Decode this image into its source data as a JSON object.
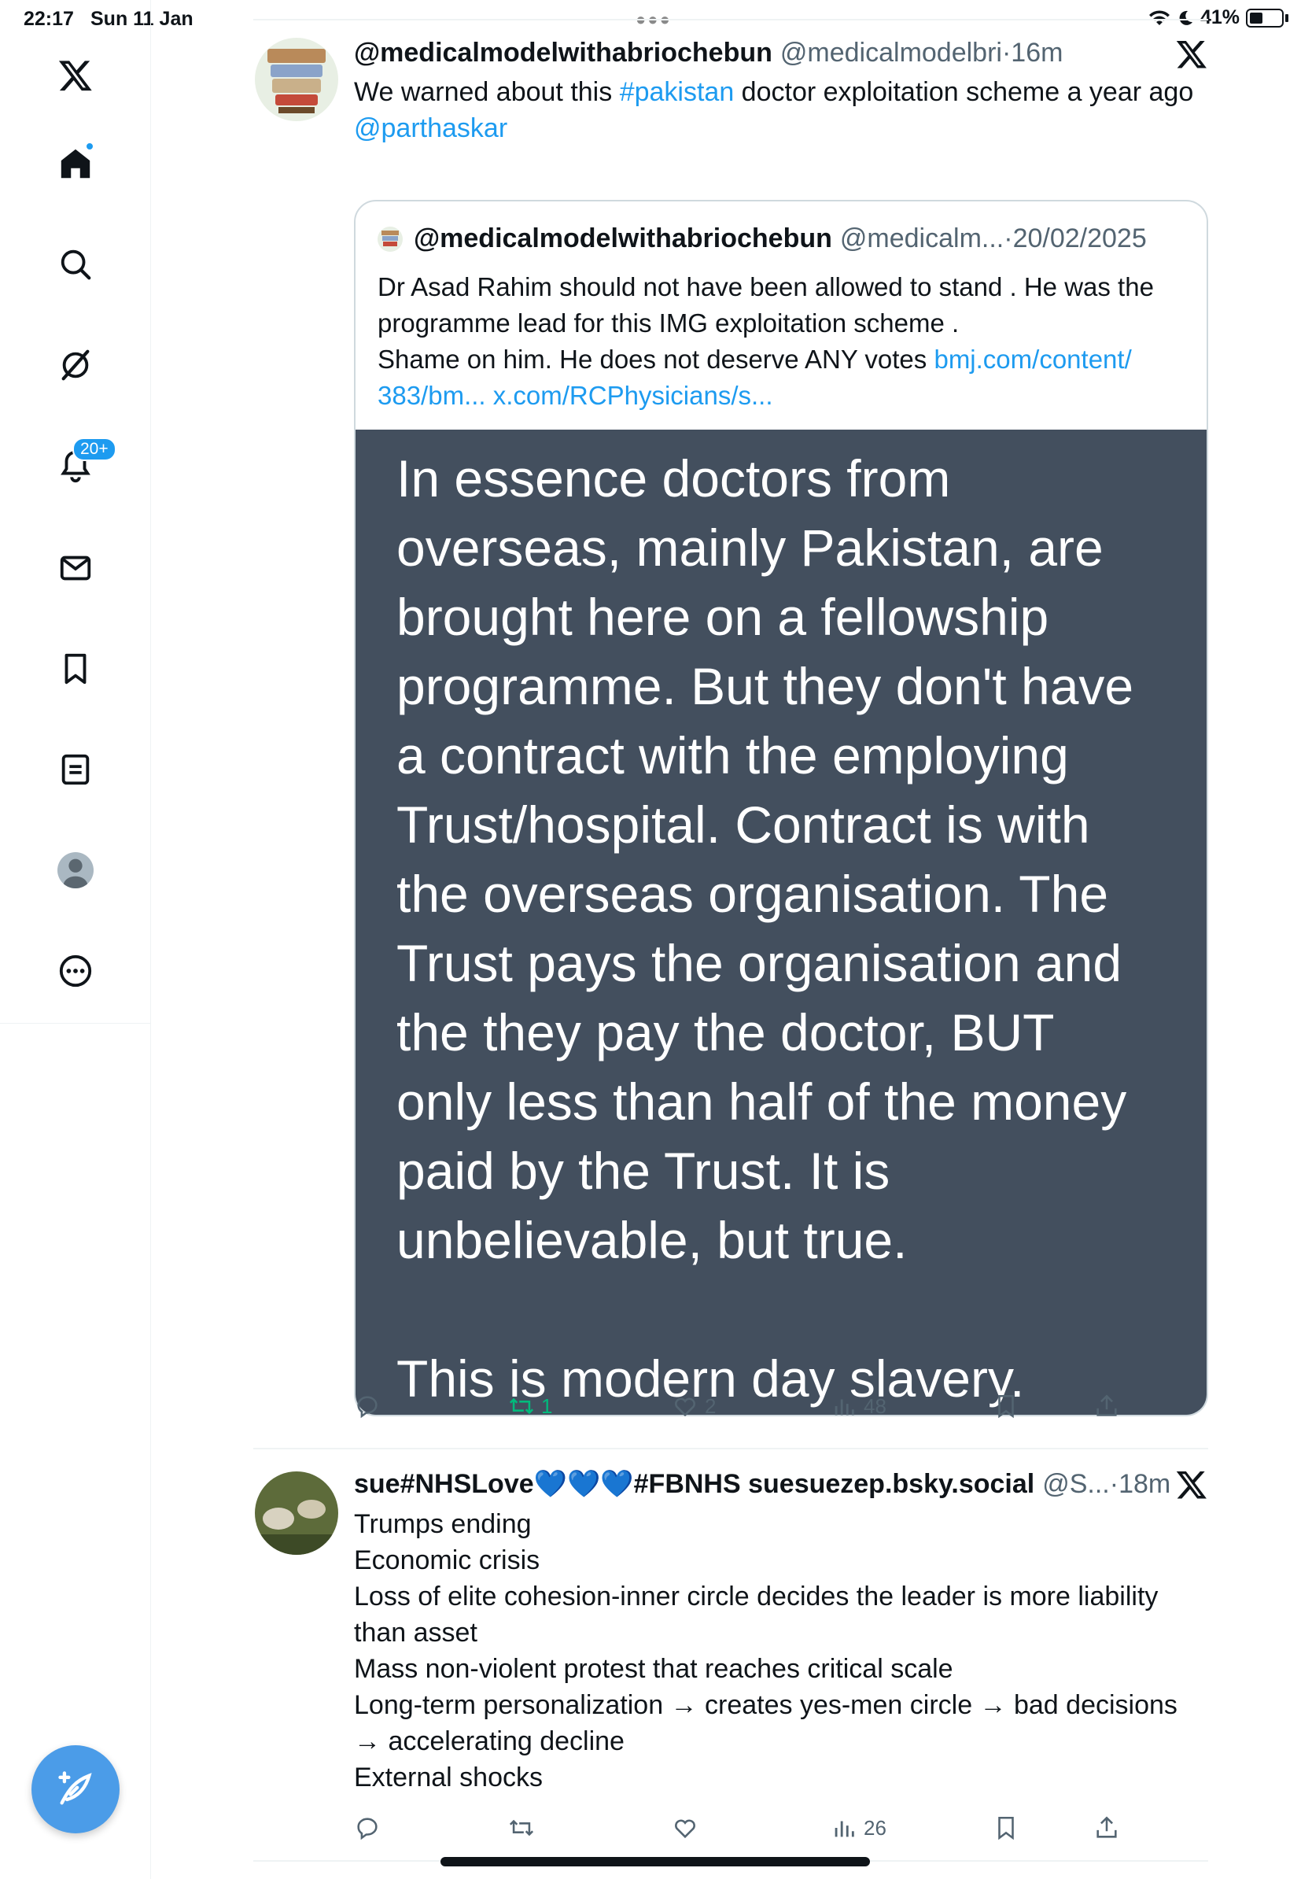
{
  "status_bar": {
    "time": "22:17",
    "date": "Sun 11 Jan",
    "battery": "41%"
  },
  "sidebar": {
    "items": [
      {
        "icon": "x-logo-icon"
      },
      {
        "icon": "home-icon"
      },
      {
        "icon": "search-icon"
      },
      {
        "icon": "grok-icon"
      },
      {
        "icon": "bell-icon",
        "badge": "20+"
      },
      {
        "icon": "mail-icon"
      },
      {
        "icon": "bookmark-icon"
      },
      {
        "icon": "lists-icon"
      },
      {
        "icon": "profile-icon"
      },
      {
        "icon": "more-icon"
      }
    ],
    "compose_icon": "compose-feather-icon"
  },
  "colors": {
    "accent": "#1d9bf0",
    "retweet": "#00ba7c",
    "muted": "#536471",
    "image_bg": "#434f5e"
  },
  "tweets": [
    {
      "display_name": "@medicalmodelwithabriochebun",
      "handle": "@medicalmodelbri",
      "separator": "·",
      "time": "16m",
      "text_before": "We warned about this ",
      "hashtag": "#pakistan",
      "text_after": " doctor exploitation scheme a year ago",
      "mention": "@parthaskar",
      "quote": {
        "display_name": "@medicalmodelwithabriochebun",
        "handle": "@medicalm...",
        "separator": "·",
        "date": "20/02/2025",
        "line1": "Dr Asad Rahim should not have been allowed to stand . He was the",
        "line2": "programme lead for this IMG exploitation scheme .",
        "line3": "Shame on him. He does not deserve ANY votes ",
        "link1a": "bmj.com/content/",
        "link1b": "383/bm...",
        "link2": "x.com/RCPhysicians/s...",
        "image_text": "In essence doctors from\noverseas, mainly Pakistan, are\nbrought here on a fellowship\nprogramme. But they don't have\na contract with the employing\nTrust/hospital. Contract is with\nthe overseas organisation. The\nTrust pays the organisation and\nthe they pay the doctor, BUT\nonly less than half of the money\npaid by the Trust. It is\nunbelievable, but true.\n\nThis is modern day slavery."
      },
      "actions": {
        "replies": "",
        "retweets": "1",
        "likes": "2",
        "views": "48"
      }
    },
    {
      "display_name": "sue#NHSLove💙💙💙#FBNHS suesuezep.bsky.social",
      "handle": "@S...",
      "separator": "·",
      "time": "18m",
      "lines": [
        "Trumps ending",
        "Economic crisis",
        "Loss of elite cohesion-inner circle  decides the leader is more liability",
        "than asset",
        "Mass non-violent protest that reaches critical scale",
        "Long-term personalization → creates yes-men circle → bad decisions",
        "→ accelerating decline",
        "External shocks"
      ],
      "actions": {
        "replies": "",
        "retweets": "",
        "likes": "",
        "views": "26"
      }
    }
  ]
}
